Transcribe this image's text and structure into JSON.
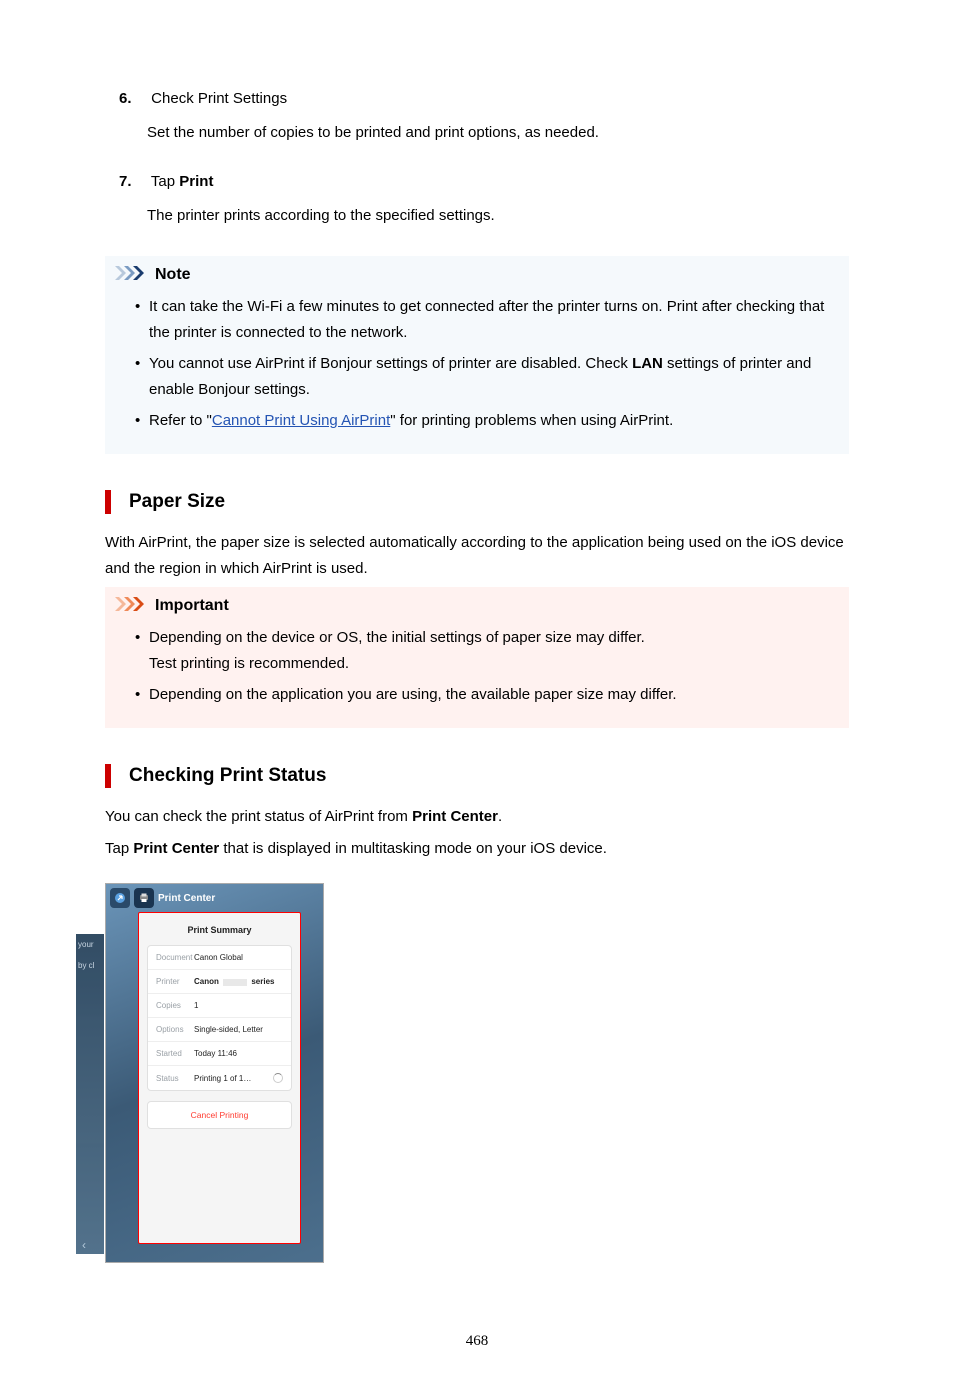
{
  "steps": [
    {
      "num": "6.",
      "title_plain": "Check Print Settings",
      "desc": "Set the number of copies to be printed and print options, as needed."
    },
    {
      "num": "7.",
      "title_pre": "Tap ",
      "title_bold": "Print",
      "desc": "The printer prints according to the specified settings."
    }
  ],
  "note": {
    "title": "Note",
    "items": {
      "i0": "It can take the Wi-Fi a few minutes to get connected after the printer turns on. Print after checking that the printer is connected to the network.",
      "i1_pre": "You cannot use AirPrint if Bonjour settings of printer are disabled. Check ",
      "i1_bold": "LAN",
      "i1_post": " settings of printer and enable Bonjour settings.",
      "i2_pre": "Refer to \"",
      "i2_link": "Cannot Print Using AirPrint",
      "i2_post": "\" for printing problems when using AirPrint."
    }
  },
  "paper_size": {
    "title": "Paper Size",
    "para": "With AirPrint, the paper size is selected automatically according to the application being used on the iOS device and the region in which AirPrint is used."
  },
  "important": {
    "title": "Important",
    "items": {
      "i0_l1": "Depending on the device or OS, the initial settings of paper size may differ.",
      "i0_l2": "Test printing is recommended.",
      "i1": "Depending on the application you are using, the available paper size may differ."
    }
  },
  "status": {
    "title": "Checking Print Status",
    "p1_pre": "You can check the print status of AirPrint from ",
    "p1_bold": "Print Center",
    "p1_post": ".",
    "p2_pre": "Tap ",
    "p2_bold": "Print Center",
    "p2_post": " that is displayed in multitasking mode on your iOS device."
  },
  "print_center": {
    "tab_label": "Print Center",
    "summary_title": "Print Summary",
    "rows": {
      "document_label": "Document",
      "document_value": "Canon Global",
      "printer_label": "Printer",
      "printer_value_pre": "Canon",
      "printer_value_post": "series",
      "copies_label": "Copies",
      "copies_value": "1",
      "options_label": "Options",
      "options_value": "Single-sided, Letter",
      "started_label": "Started",
      "started_value": "Today 11:46",
      "status_label": "Status",
      "status_value": "Printing 1 of 1…"
    },
    "cancel": "Cancel Printing"
  },
  "page_number": "468"
}
